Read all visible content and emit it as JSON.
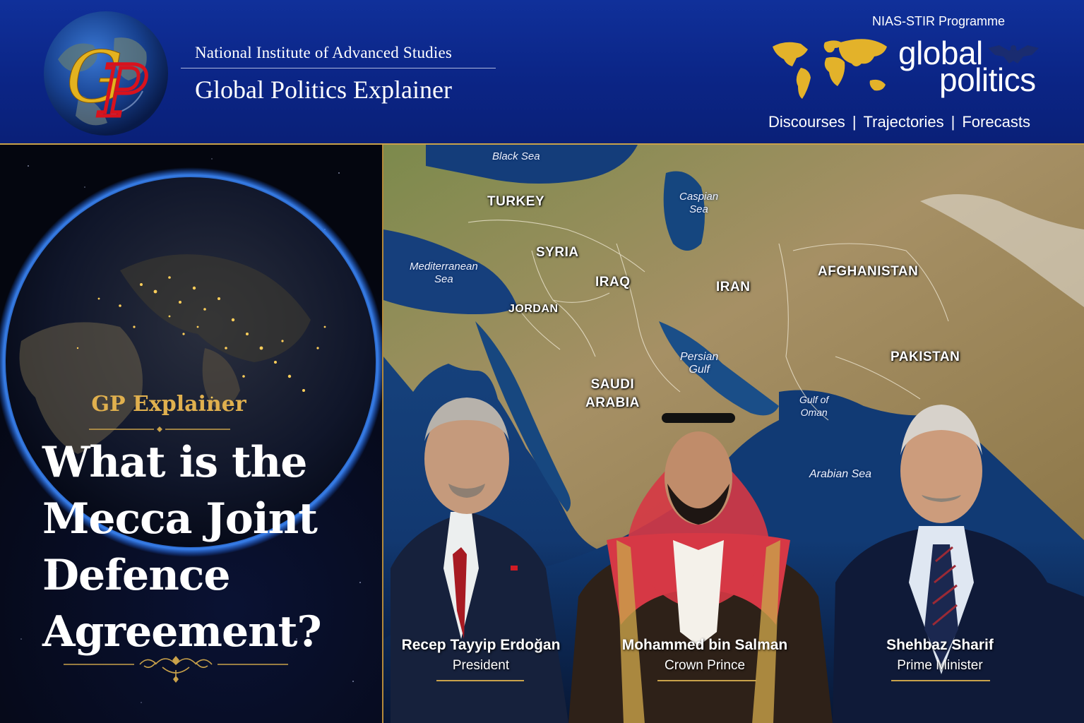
{
  "header": {
    "institute": "National Institute of Advanced Studies",
    "series": "Global Politics Explainer",
    "programme": "NIAS-STIR Programme",
    "brand_line1": "global",
    "brand_line2": "politics",
    "tags": [
      "Discourses",
      "Trajectories",
      "Forecasts"
    ],
    "logo_letters": "GP"
  },
  "left": {
    "kicker": "GP Explainer",
    "title_lines": [
      "What is the",
      "Mecca Joint",
      "Defence",
      "Agreement?"
    ]
  },
  "map": {
    "countries": [
      "TURKEY",
      "SYRIA",
      "IRAQ",
      "JORDAN",
      "IRAN",
      "AFGHANISTAN",
      "PAKISTAN",
      "SAUDI",
      "ARABIA"
    ],
    "seas": {
      "black": "Black Sea",
      "caspian1": "Caspian",
      "caspian2": "Sea",
      "med1": "Mediterranean",
      "med2": "Sea",
      "persian1": "Persian",
      "persian2": "Gulf",
      "oman1": "Gulf of",
      "oman2": "Oman",
      "arabian": "Arabian Sea"
    }
  },
  "leaders": [
    {
      "name": "Recep Tayyip Erdoğan",
      "role": "President"
    },
    {
      "name": "Mohammed bin Salman",
      "role": "Crown Prince"
    },
    {
      "name": "Shehbaz Sharif",
      "role": "Prime Minister"
    }
  ],
  "colors": {
    "header_blue": "#0b2586",
    "gold": "#c9a24a",
    "kicker_gold": "#e0b04e",
    "sea_blue": "#123e78",
    "land": "#9c8650"
  }
}
